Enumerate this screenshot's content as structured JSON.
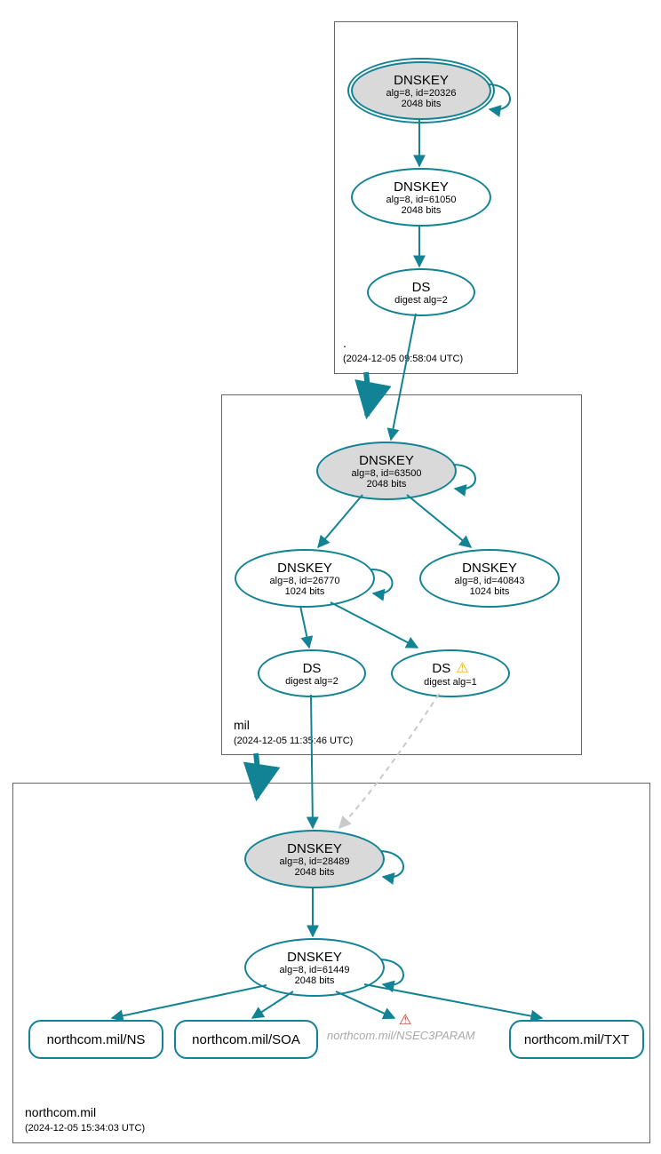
{
  "zones": {
    "root": {
      "label": ".",
      "time": "(2024-12-05 09:58:04 UTC)"
    },
    "mil": {
      "label": "mil",
      "time": "(2024-12-05 11:35:46 UTC)"
    },
    "northcom": {
      "label": "northcom.mil",
      "time": "(2024-12-05 15:34:03 UTC)"
    }
  },
  "nodes": {
    "root_ksk": {
      "title": "DNSKEY",
      "sub1": "alg=8, id=20326",
      "sub2": "2048 bits"
    },
    "root_zsk": {
      "title": "DNSKEY",
      "sub1": "alg=8, id=61050",
      "sub2": "2048 bits"
    },
    "root_ds": {
      "title": "DS",
      "sub1": "digest alg=2"
    },
    "mil_ksk": {
      "title": "DNSKEY",
      "sub1": "alg=8, id=63500",
      "sub2": "2048 bits"
    },
    "mil_zsk": {
      "title": "DNSKEY",
      "sub1": "alg=8, id=26770",
      "sub2": "1024 bits"
    },
    "mil_zsk2": {
      "title": "DNSKEY",
      "sub1": "alg=8, id=40843",
      "sub2": "1024 bits"
    },
    "mil_ds": {
      "title": "DS",
      "sub1": "digest alg=2"
    },
    "mil_ds_w": {
      "title": "DS",
      "sub1": "digest alg=1",
      "warn": "⚠"
    },
    "nc_ksk": {
      "title": "DNSKEY",
      "sub1": "alg=8, id=28489",
      "sub2": "2048 bits"
    },
    "nc_zsk": {
      "title": "DNSKEY",
      "sub1": "alg=8, id=61449",
      "sub2": "2048 bits"
    }
  },
  "leaves": {
    "ns": "northcom.mil/NS",
    "soa": "northcom.mil/SOA",
    "nsec": "northcom.mil/NSEC3PARAM",
    "txt": "northcom.mil/TXT"
  },
  "icons": {
    "warn": "⚠",
    "err": "⚠"
  }
}
